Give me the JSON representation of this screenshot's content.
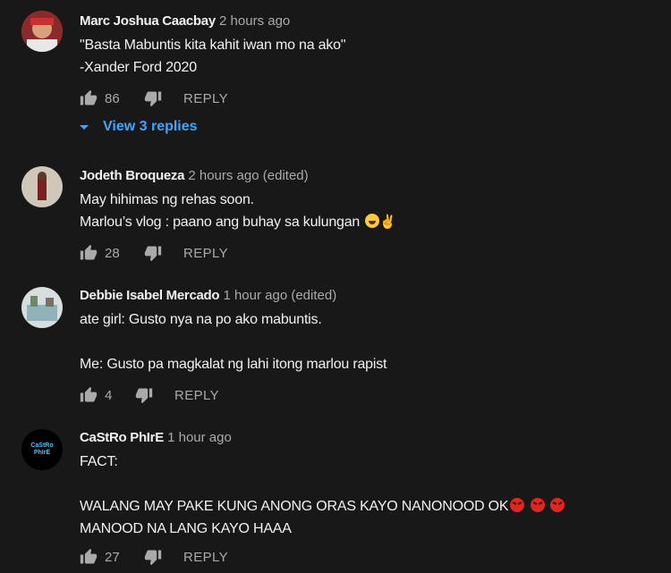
{
  "comments": [
    {
      "author": "Marc Joshua Caacbay",
      "time": "2 hours ago",
      "edited": "",
      "lines": "\"Basta Mabuntis kita kahit iwan mo na ako\"\n-Xander Ford 2020",
      "likes": "86",
      "reply_label": "REPLY",
      "view_replies": "View 3 replies"
    },
    {
      "author": "Jodeth Broqueza",
      "time": "2 hours ago",
      "edited": "(edited)",
      "line1": "May hihimas ng rehas soon.",
      "line2": "Marlou’s vlog : paano ang buhay sa kulungan",
      "likes": "28",
      "reply_label": "REPLY"
    },
    {
      "author": "Debbie Isabel Mercado",
      "time": "1 hour ago",
      "edited": "(edited)",
      "lines": "ate girl: Gusto nya na po ako mabuntis.\n\nMe: Gusto pa magkalat ng lahi itong marlou rapist",
      "likes": "4",
      "reply_label": "REPLY"
    },
    {
      "author": "CaStRo PhIrE",
      "time": "1 hour ago",
      "edited": "",
      "line1": "FACT:",
      "line2": "WALANG MAY PAKE KUNG ANONG ORAS KAYO NANONOOD OK",
      "line3": "MANOOD NA LANG KAYO HAAA",
      "avatar_text": "CaStRo PhIrE",
      "likes": "27",
      "reply_label": "REPLY"
    }
  ],
  "colors": {
    "background": "#181818",
    "text": "#f1f1f1",
    "secondary": "#aaaaaa",
    "link": "#3ea6ff"
  },
  "icons": {
    "like": "thumb-up-icon",
    "dislike": "thumb-down-icon",
    "expand": "caret-down-icon"
  }
}
